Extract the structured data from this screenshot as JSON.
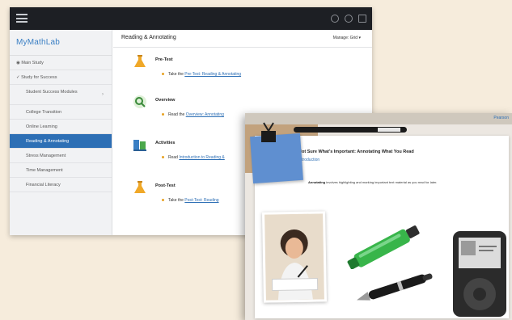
{
  "back_window": {
    "brand": "MyMathLab",
    "sidebar": {
      "items": [
        {
          "label": "◉ Main Study"
        },
        {
          "label": "✓ Study for Success"
        },
        {
          "label": "Student Success Modules"
        },
        {
          "label": "College Transition"
        },
        {
          "label": "Online Learning"
        },
        {
          "label": "Reading & Annotating"
        },
        {
          "label": "Stress Management"
        },
        {
          "label": "Time Management"
        },
        {
          "label": "Financial Literacy"
        }
      ],
      "active_index": 5
    },
    "content": {
      "title": "Reading & Annotating",
      "manager": "Manage: Grid ▾",
      "steps": [
        {
          "label": "Pre-Test",
          "prefix": "Take the ",
          "link": "Pre-Test: Reading & Annotating",
          "icon": "flask-icon"
        },
        {
          "label": "Overview",
          "prefix": "Read the ",
          "link": "Overview: Annotating",
          "icon": "magnifier-icon"
        },
        {
          "label": "Activities",
          "prefix": "Read ",
          "link": "Introduction to Reading &",
          "icon": "books-icon"
        },
        {
          "label": "Post-Test",
          "prefix": "Take the ",
          "link": "Post-Test: Reading",
          "icon": "flask-icon"
        }
      ]
    }
  },
  "front_window": {
    "brand": "Pearson",
    "lesson_title": "Not Sure What's Important: Annotating What You Read",
    "lesson_subtitle": "Introduction",
    "lesson_body_bold": "Annotating",
    "lesson_body_rest": " involves highlighting and marking important text material as you read for later.",
    "colors": {
      "highlighter": "#38b54a",
      "sticky_note": "#5f8fd0"
    }
  },
  "colors": {
    "accent": "#2d6fb5",
    "topbar": "#1d1f24",
    "step_dot": "#e8a324"
  }
}
